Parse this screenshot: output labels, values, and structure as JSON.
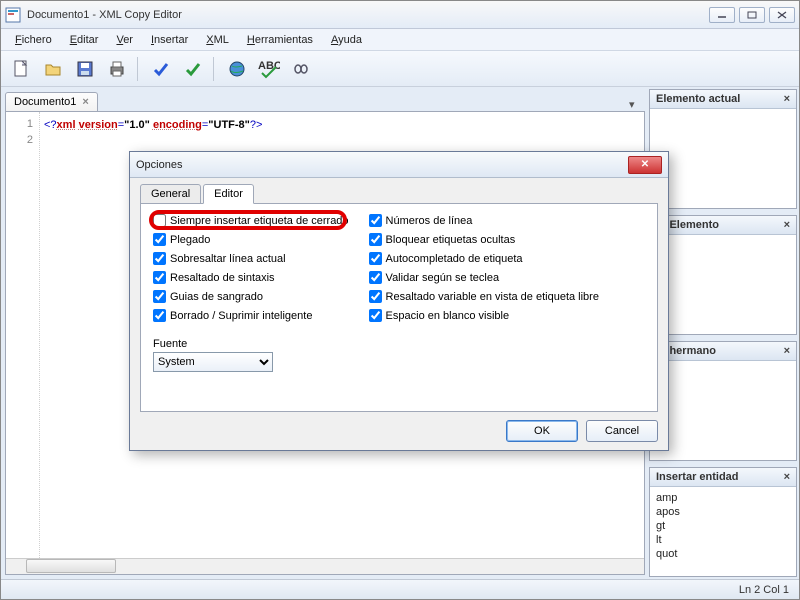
{
  "window": {
    "title": "Documento1 - XML Copy Editor"
  },
  "menus": {
    "fichero": "Fichero",
    "editar": "Editar",
    "ver": "Ver",
    "insertar": "Insertar",
    "xml": "XML",
    "herramientas": "Herramientas",
    "ayuda": "Ayuda"
  },
  "document_tab": {
    "name": "Documento1"
  },
  "code_lines": {
    "l1": "1",
    "l2": "2"
  },
  "code": {
    "p1": "<?",
    "kw1": "xml",
    "sp1": " ",
    "attr1": "version",
    "eq1": "=",
    "v1": "\"1.0\"",
    "sp2": " ",
    "attr2": "encoding",
    "eq2": "=",
    "v2": "\"UTF-8\"",
    "p2": "?>"
  },
  "panels": {
    "elemento_actual": "Elemento actual",
    "insertar_elemento": "ar Elemento",
    "insertar_hermano": "ar hermano",
    "insertar_entidad": "Insertar entidad"
  },
  "entities": {
    "amp": "amp",
    "apos": "apos",
    "gt": "gt",
    "lt": "lt",
    "quot": "quot"
  },
  "status": {
    "pos": "Ln 2 Col 1"
  },
  "dialog": {
    "title": "Opciones",
    "tabs": {
      "general": "General",
      "editor": "Editor"
    },
    "left": {
      "close_tag": "Siempre insertar etiqueta de cerrado",
      "plegado": "Plegado",
      "sobresaltar": "Sobresaltar línea actual",
      "sintaxis": "Resaltado de sintaxis",
      "sangrado": "Guias de sangrado",
      "borrado": "Borrado / Suprimir inteligente"
    },
    "right": {
      "lineas": "Números de línea",
      "bloquear": "Bloquear etiquetas ocultas",
      "autocompletado": "Autocompletado de etiqueta",
      "validar": "Validar según se teclea",
      "resaltado_var": "Resaltado variable en vista de etiqueta libre",
      "espacio": "Espacio en blanco visible"
    },
    "fuente_label": "Fuente",
    "fuente_value": "System",
    "ok": "OK",
    "cancel": "Cancel"
  }
}
